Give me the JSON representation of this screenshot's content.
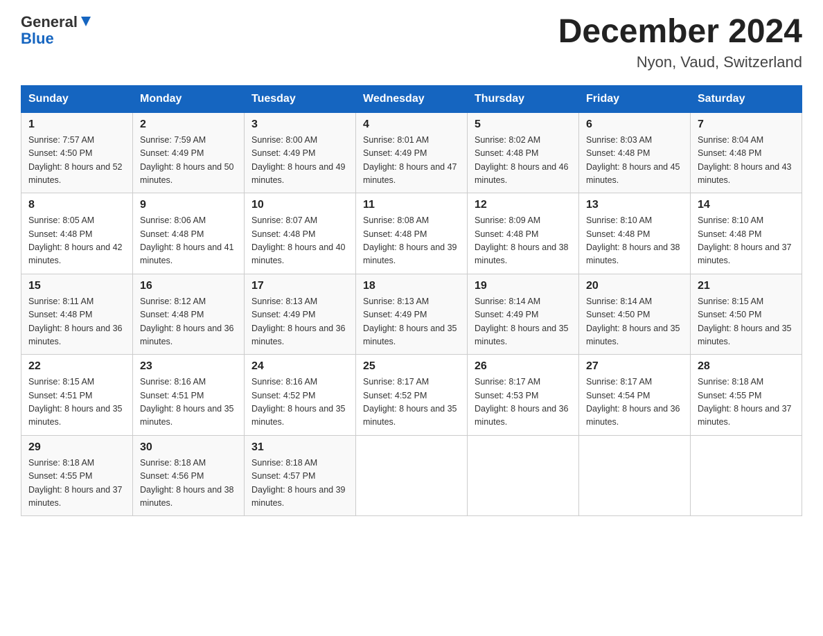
{
  "header": {
    "logo_general": "General",
    "logo_blue": "Blue",
    "month_title": "December 2024",
    "location": "Nyon, Vaud, Switzerland"
  },
  "columns": [
    "Sunday",
    "Monday",
    "Tuesday",
    "Wednesday",
    "Thursday",
    "Friday",
    "Saturday"
  ],
  "weeks": [
    [
      {
        "day": "1",
        "sunrise": "7:57 AM",
        "sunset": "4:50 PM",
        "daylight": "8 hours and 52 minutes."
      },
      {
        "day": "2",
        "sunrise": "7:59 AM",
        "sunset": "4:49 PM",
        "daylight": "8 hours and 50 minutes."
      },
      {
        "day": "3",
        "sunrise": "8:00 AM",
        "sunset": "4:49 PM",
        "daylight": "8 hours and 49 minutes."
      },
      {
        "day": "4",
        "sunrise": "8:01 AM",
        "sunset": "4:49 PM",
        "daylight": "8 hours and 47 minutes."
      },
      {
        "day": "5",
        "sunrise": "8:02 AM",
        "sunset": "4:48 PM",
        "daylight": "8 hours and 46 minutes."
      },
      {
        "day": "6",
        "sunrise": "8:03 AM",
        "sunset": "4:48 PM",
        "daylight": "8 hours and 45 minutes."
      },
      {
        "day": "7",
        "sunrise": "8:04 AM",
        "sunset": "4:48 PM",
        "daylight": "8 hours and 43 minutes."
      }
    ],
    [
      {
        "day": "8",
        "sunrise": "8:05 AM",
        "sunset": "4:48 PM",
        "daylight": "8 hours and 42 minutes."
      },
      {
        "day": "9",
        "sunrise": "8:06 AM",
        "sunset": "4:48 PM",
        "daylight": "8 hours and 41 minutes."
      },
      {
        "day": "10",
        "sunrise": "8:07 AM",
        "sunset": "4:48 PM",
        "daylight": "8 hours and 40 minutes."
      },
      {
        "day": "11",
        "sunrise": "8:08 AM",
        "sunset": "4:48 PM",
        "daylight": "8 hours and 39 minutes."
      },
      {
        "day": "12",
        "sunrise": "8:09 AM",
        "sunset": "4:48 PM",
        "daylight": "8 hours and 38 minutes."
      },
      {
        "day": "13",
        "sunrise": "8:10 AM",
        "sunset": "4:48 PM",
        "daylight": "8 hours and 38 minutes."
      },
      {
        "day": "14",
        "sunrise": "8:10 AM",
        "sunset": "4:48 PM",
        "daylight": "8 hours and 37 minutes."
      }
    ],
    [
      {
        "day": "15",
        "sunrise": "8:11 AM",
        "sunset": "4:48 PM",
        "daylight": "8 hours and 36 minutes."
      },
      {
        "day": "16",
        "sunrise": "8:12 AM",
        "sunset": "4:48 PM",
        "daylight": "8 hours and 36 minutes."
      },
      {
        "day": "17",
        "sunrise": "8:13 AM",
        "sunset": "4:49 PM",
        "daylight": "8 hours and 36 minutes."
      },
      {
        "day": "18",
        "sunrise": "8:13 AM",
        "sunset": "4:49 PM",
        "daylight": "8 hours and 35 minutes."
      },
      {
        "day": "19",
        "sunrise": "8:14 AM",
        "sunset": "4:49 PM",
        "daylight": "8 hours and 35 minutes."
      },
      {
        "day": "20",
        "sunrise": "8:14 AM",
        "sunset": "4:50 PM",
        "daylight": "8 hours and 35 minutes."
      },
      {
        "day": "21",
        "sunrise": "8:15 AM",
        "sunset": "4:50 PM",
        "daylight": "8 hours and 35 minutes."
      }
    ],
    [
      {
        "day": "22",
        "sunrise": "8:15 AM",
        "sunset": "4:51 PM",
        "daylight": "8 hours and 35 minutes."
      },
      {
        "day": "23",
        "sunrise": "8:16 AM",
        "sunset": "4:51 PM",
        "daylight": "8 hours and 35 minutes."
      },
      {
        "day": "24",
        "sunrise": "8:16 AM",
        "sunset": "4:52 PM",
        "daylight": "8 hours and 35 minutes."
      },
      {
        "day": "25",
        "sunrise": "8:17 AM",
        "sunset": "4:52 PM",
        "daylight": "8 hours and 35 minutes."
      },
      {
        "day": "26",
        "sunrise": "8:17 AM",
        "sunset": "4:53 PM",
        "daylight": "8 hours and 36 minutes."
      },
      {
        "day": "27",
        "sunrise": "8:17 AM",
        "sunset": "4:54 PM",
        "daylight": "8 hours and 36 minutes."
      },
      {
        "day": "28",
        "sunrise": "8:18 AM",
        "sunset": "4:55 PM",
        "daylight": "8 hours and 37 minutes."
      }
    ],
    [
      {
        "day": "29",
        "sunrise": "8:18 AM",
        "sunset": "4:55 PM",
        "daylight": "8 hours and 37 minutes."
      },
      {
        "day": "30",
        "sunrise": "8:18 AM",
        "sunset": "4:56 PM",
        "daylight": "8 hours and 38 minutes."
      },
      {
        "day": "31",
        "sunrise": "8:18 AM",
        "sunset": "4:57 PM",
        "daylight": "8 hours and 39 minutes."
      },
      null,
      null,
      null,
      null
    ]
  ],
  "labels": {
    "sunrise": "Sunrise:",
    "sunset": "Sunset:",
    "daylight": "Daylight:"
  }
}
